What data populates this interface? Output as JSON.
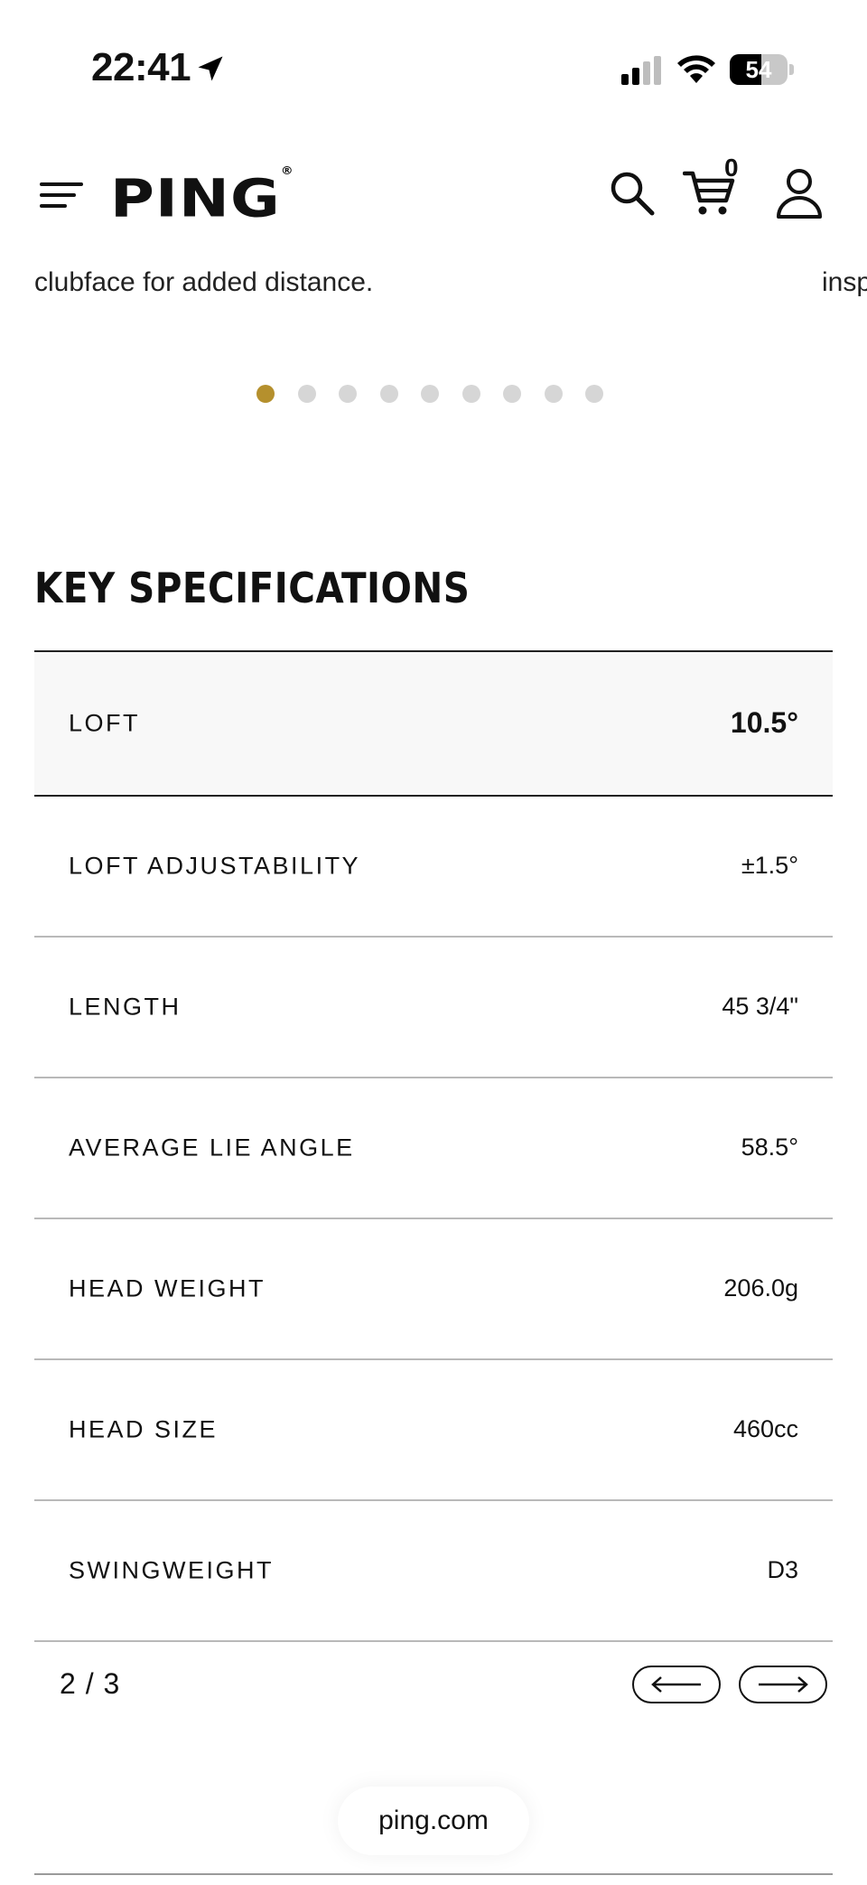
{
  "status_bar": {
    "time": "22:41",
    "battery_level": "54",
    "battery_fraction": 0.54
  },
  "header": {
    "logo": "PING",
    "cart_count": "0"
  },
  "carousel": {
    "text_left": "clubface for added distance.",
    "text_right": "insp",
    "dot_count": 9,
    "active_index": 0,
    "active_color": "#b5902d"
  },
  "specs": {
    "title": "KEY SPECIFICATIONS",
    "rows": [
      {
        "label": "LOFT",
        "value": "10.5°"
      },
      {
        "label": "LOFT ADJUSTABILITY",
        "value": "±1.5°"
      },
      {
        "label": "LENGTH",
        "value": "45 3/4\""
      },
      {
        "label": "AVERAGE LIE ANGLE",
        "value": "58.5°"
      },
      {
        "label": "HEAD WEIGHT",
        "value": "206.0g"
      },
      {
        "label": "HEAD SIZE",
        "value": "460cc"
      },
      {
        "label": "SWINGWEIGHT",
        "value": "D3"
      }
    ],
    "pager": "2 / 3"
  },
  "browser": {
    "url": "ping.com"
  },
  "icons": {
    "menu": "hamburger-menu-icon",
    "search": "search-icon",
    "cart": "cart-icon",
    "account": "user-icon",
    "prev": "arrow-left-icon",
    "next": "arrow-right-icon"
  }
}
